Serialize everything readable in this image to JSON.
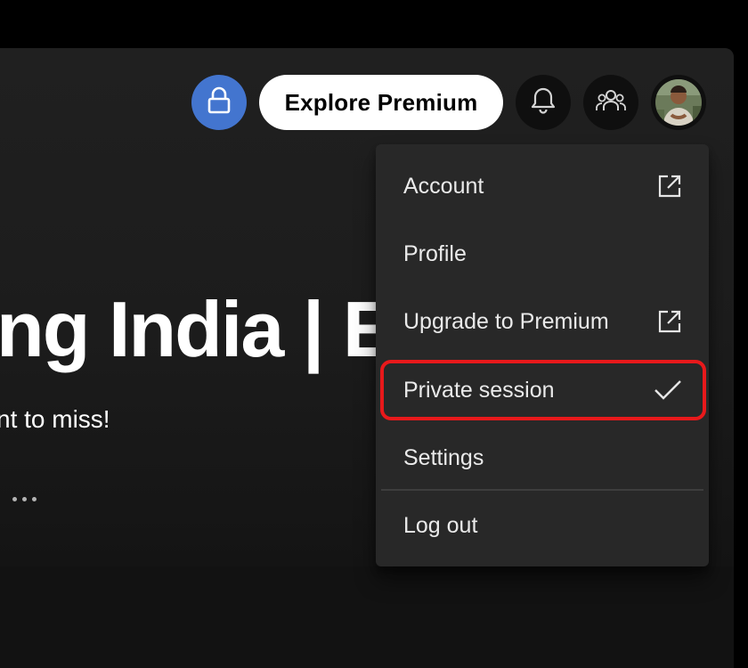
{
  "hero": {
    "title": "ng India | E",
    "subtitle": "nt to miss!"
  },
  "topbar": {
    "premium_label": "Explore Premium",
    "lock_icon": "lock-icon",
    "bell_icon": "bell-icon",
    "friends_icon": "friends-icon",
    "avatar": "user-avatar"
  },
  "menu": {
    "items": [
      {
        "label": "Account",
        "icon": "external-link-icon"
      },
      {
        "label": "Profile",
        "icon": ""
      },
      {
        "label": "Upgrade to Premium",
        "icon": "external-link-icon"
      },
      {
        "label": "Private session",
        "icon": "check-icon",
        "checked": true
      },
      {
        "label": "Settings",
        "icon": ""
      },
      {
        "label": "Log out",
        "icon": ""
      }
    ]
  },
  "colors": {
    "accent_blue": "#4375cf",
    "highlight_red": "#e8191b",
    "menu_bg": "#282828",
    "app_bg": "#121212"
  }
}
